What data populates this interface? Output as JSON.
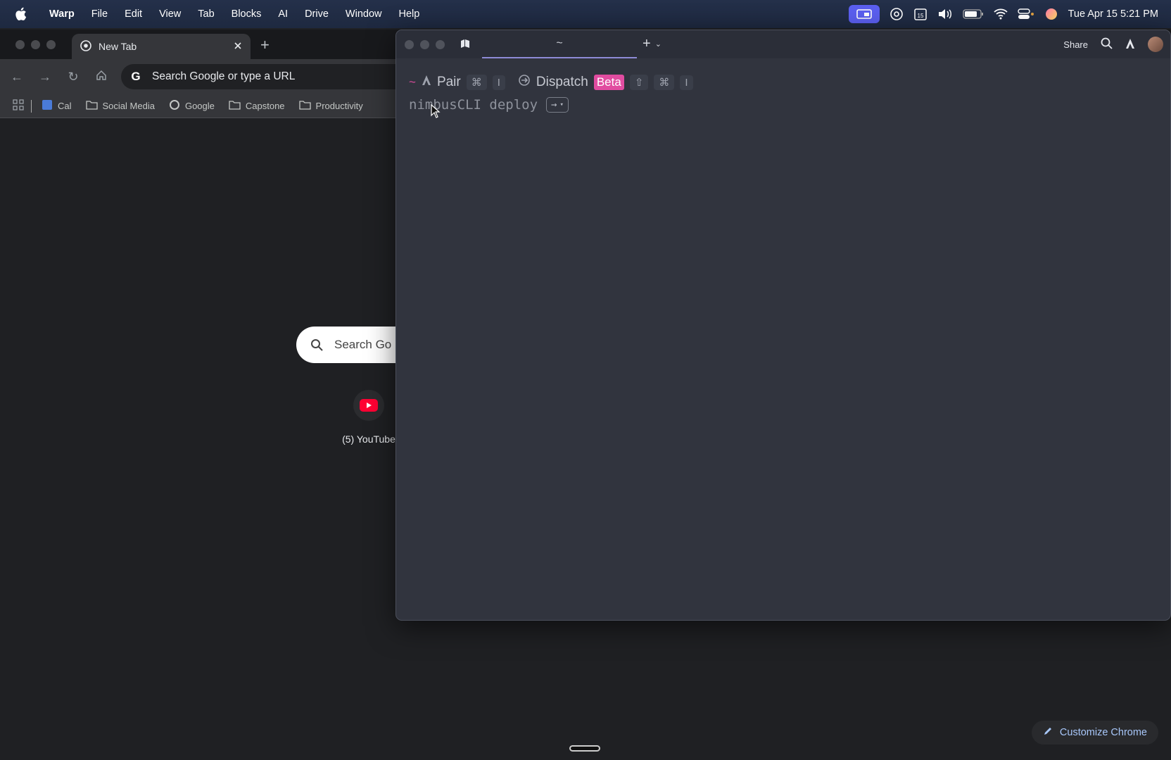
{
  "menubar": {
    "app": "Warp",
    "items": [
      "File",
      "Edit",
      "View",
      "Tab",
      "Blocks",
      "AI",
      "Drive",
      "Window",
      "Help"
    ],
    "clock": "Tue Apr 15  5:21 PM",
    "status_icons": [
      "screen-mirroring-icon",
      "at-icon",
      "calendar-icon",
      "volume-icon",
      "battery-icon",
      "wifi-icon",
      "control-center-icon",
      "siri-icon"
    ],
    "calendar_day": "15"
  },
  "chrome": {
    "tab_title": "New Tab",
    "omnibox_placeholder": "Search Google or type a URL",
    "bookmarks": [
      "Cal",
      "Social Media",
      "Google",
      "Capstone",
      "Productivity"
    ],
    "ntp_search_placeholder": "Search Go",
    "shortcut_label": "(5) YouTube",
    "customize_label": "Customize Chrome"
  },
  "warp": {
    "tab_label": "~",
    "share_label": "Share",
    "prompt": {
      "pair_label": "Pair",
      "pair_shortcut": "⌘",
      "pair_key": "I",
      "dispatch_label": "Dispatch",
      "beta_badge": "Beta",
      "dispatch_shift": "⇧",
      "dispatch_cmd": "⌘",
      "dispatch_key": "I"
    },
    "input_text": "nimbusCLI deploy",
    "run_chip": "→"
  },
  "colors": {
    "warp_accent": "#8d8ad6",
    "beta": "#e14ca0",
    "youtube": "#ff0033"
  }
}
